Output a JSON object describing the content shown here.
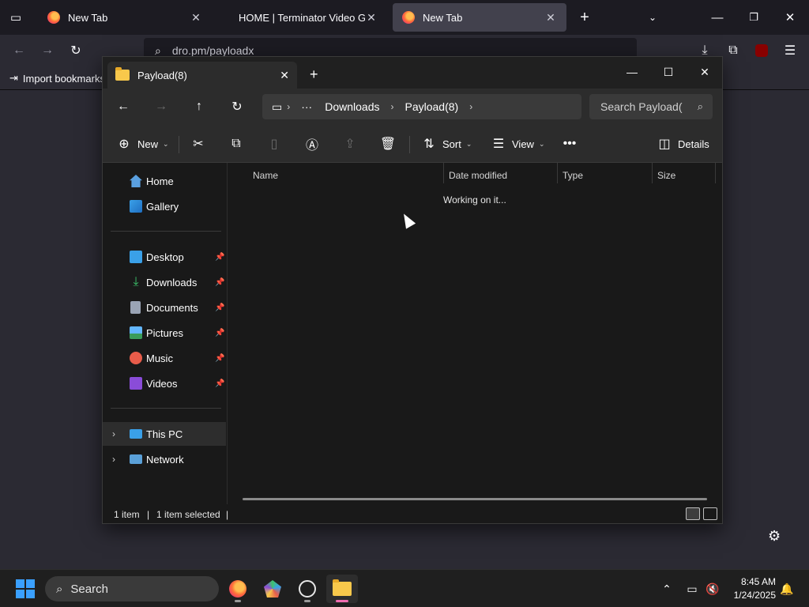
{
  "firefox": {
    "tabs": [
      {
        "title": "New Tab",
        "active": false
      },
      {
        "title": "HOME | Terminator Video Game",
        "active": false
      },
      {
        "title": "New Tab",
        "active": true
      }
    ],
    "url": "dro.pm/payloadx",
    "bookmarks": {
      "import_label": "Import bookmarks..."
    }
  },
  "explorer": {
    "tab_title": "Payload(8)",
    "breadcrumb": [
      "Downloads",
      "Payload(8)"
    ],
    "search_placeholder": "Search Payload(",
    "toolbar": {
      "new_label": "New",
      "sort_label": "Sort",
      "view_label": "View",
      "details_label": "Details"
    },
    "sidebar": {
      "top": [
        {
          "label": "Home",
          "icon": "home-icon"
        },
        {
          "label": "Gallery",
          "icon": "gallery-icon"
        }
      ],
      "pinned": [
        {
          "label": "Desktop",
          "icon": "desktop-icon",
          "color": "#3aa0e8"
        },
        {
          "label": "Downloads",
          "icon": "download-icon",
          "color": "#3cc36b"
        },
        {
          "label": "Documents",
          "icon": "documents-icon",
          "color": "#9aa4b5"
        },
        {
          "label": "Pictures",
          "icon": "pictures-icon",
          "color": "#3a9cf0"
        },
        {
          "label": "Music",
          "icon": "music-icon",
          "color": "#e85c4a"
        },
        {
          "label": "Videos",
          "icon": "videos-icon",
          "color": "#8a4cd8"
        }
      ],
      "drives": [
        {
          "label": "This PC",
          "icon": "pc-icon"
        },
        {
          "label": "Network",
          "icon": "network-icon"
        }
      ]
    },
    "columns": [
      "Name",
      "Date modified",
      "Type",
      "Size"
    ],
    "working_text": "Working on it...",
    "status": {
      "items": "1 item",
      "selected": "1 item selected"
    }
  },
  "taskbar": {
    "search_label": "Search",
    "time": "8:45 AM",
    "date": "1/24/2025"
  }
}
